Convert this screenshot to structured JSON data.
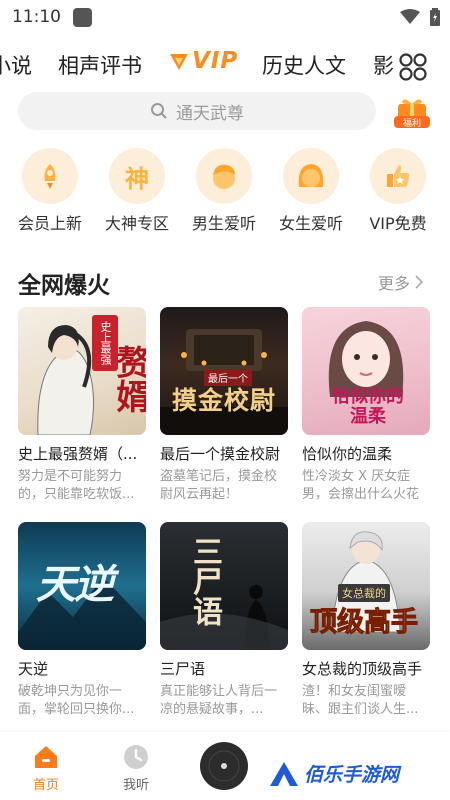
{
  "status_bar": {
    "time": "11:10"
  },
  "tabs": {
    "items": [
      "小说",
      "相声评书",
      "VIP",
      "历史人文",
      "影"
    ],
    "active": "VIP",
    "accent": "#ff8a1e"
  },
  "search": {
    "placeholder": "通天武尊",
    "gift_label": "福利"
  },
  "quick_categories": [
    {
      "label": "会员上新",
      "icon": "rocket-icon"
    },
    {
      "label": "大神专区",
      "icon": "god-badge-icon",
      "glyph": "神"
    },
    {
      "label": "男生爱听",
      "icon": "male-face-icon"
    },
    {
      "label": "女生爱听",
      "icon": "female-face-icon"
    },
    {
      "label": "VIP免费",
      "icon": "thumbs-up-icon"
    }
  ],
  "section": {
    "title": "全网爆火",
    "more_label": "更多"
  },
  "books": [
    {
      "title": "史上最强赘婿（...",
      "desc": "努力是不可能努力的，只能靠吃软饭...",
      "cover_text": "赘婿",
      "cover_badge": "史上最强"
    },
    {
      "title": "最后一个摸金校尉",
      "desc": "盗墓笔记后，摸金校尉风云再起！",
      "cover_text": "摸金校尉",
      "cover_badge": "最后一个"
    },
    {
      "title": "恰似你的温柔",
      "desc": "性冷淡女 X 厌女症男，会擦出什么火花",
      "cover_text": "恰似你的温柔"
    },
    {
      "title": "天逆",
      "desc": "破乾坤只为见你一面，掌轮回只换你...",
      "cover_text": "天逆"
    },
    {
      "title": "三尸语",
      "desc": "真正能够让人背后一凉的悬疑故事，...",
      "cover_text": "三尸语"
    },
    {
      "title": "女总裁的顶级高手",
      "desc": "渣！和女友闺蜜暧昧、跟主们谈人生...",
      "cover_text": "顶级高手",
      "cover_badge": "女总裁的"
    }
  ],
  "bottom_nav": {
    "home_label": "首页",
    "listen_label": "我听",
    "watermark": "佰乐手游网",
    "active_color": "#ff7a1a"
  }
}
